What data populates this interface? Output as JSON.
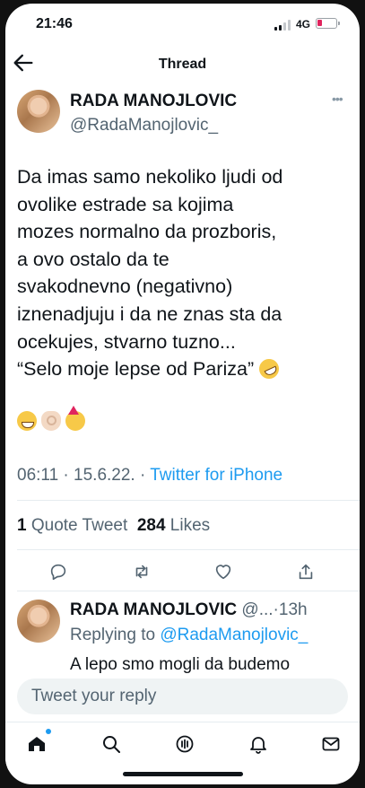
{
  "status_bar": {
    "time": "21:46",
    "network": "4G"
  },
  "header": {
    "title": "Thread"
  },
  "main_tweet": {
    "display_name": "RADA MANOJLOVIC",
    "handle": "@RadaManojlovic_",
    "text_lines": [
      "Da imas samo nekoliko ljudi od",
      "ovolike estrade sa kojima",
      "mozes normalno da prozboris,",
      "a ovo ostalo da te",
      "svakodnevno (negativno)",
      "iznenadjuju i da ne znas sta da",
      "ocekujes, stvarno tuzno...",
      "“Selo moje lepse od Pariza”"
    ],
    "emojis": [
      "grinning-face-emoji",
      "ok-hand-emoji",
      "partying-face-emoji",
      "rofl-emoji"
    ],
    "time": "06:11",
    "date": "15.6.22.",
    "source": "Twitter for iPhone",
    "quote_count": "1",
    "quote_label": "Quote Tweet",
    "like_count": "284",
    "like_label": "Likes"
  },
  "reply": {
    "display_name": "RADA MANOJLOVIC",
    "handle_short": "@...",
    "age": "13h",
    "replying_label": "Replying to",
    "replying_to": "@RadaManojlovic_",
    "text": "A lepo smo mogli da budemo"
  },
  "composer": {
    "placeholder": "Tweet your reply"
  },
  "colors": {
    "accent": "#1d9bf0",
    "text_primary": "#0f1419",
    "text_secondary": "#536471"
  }
}
